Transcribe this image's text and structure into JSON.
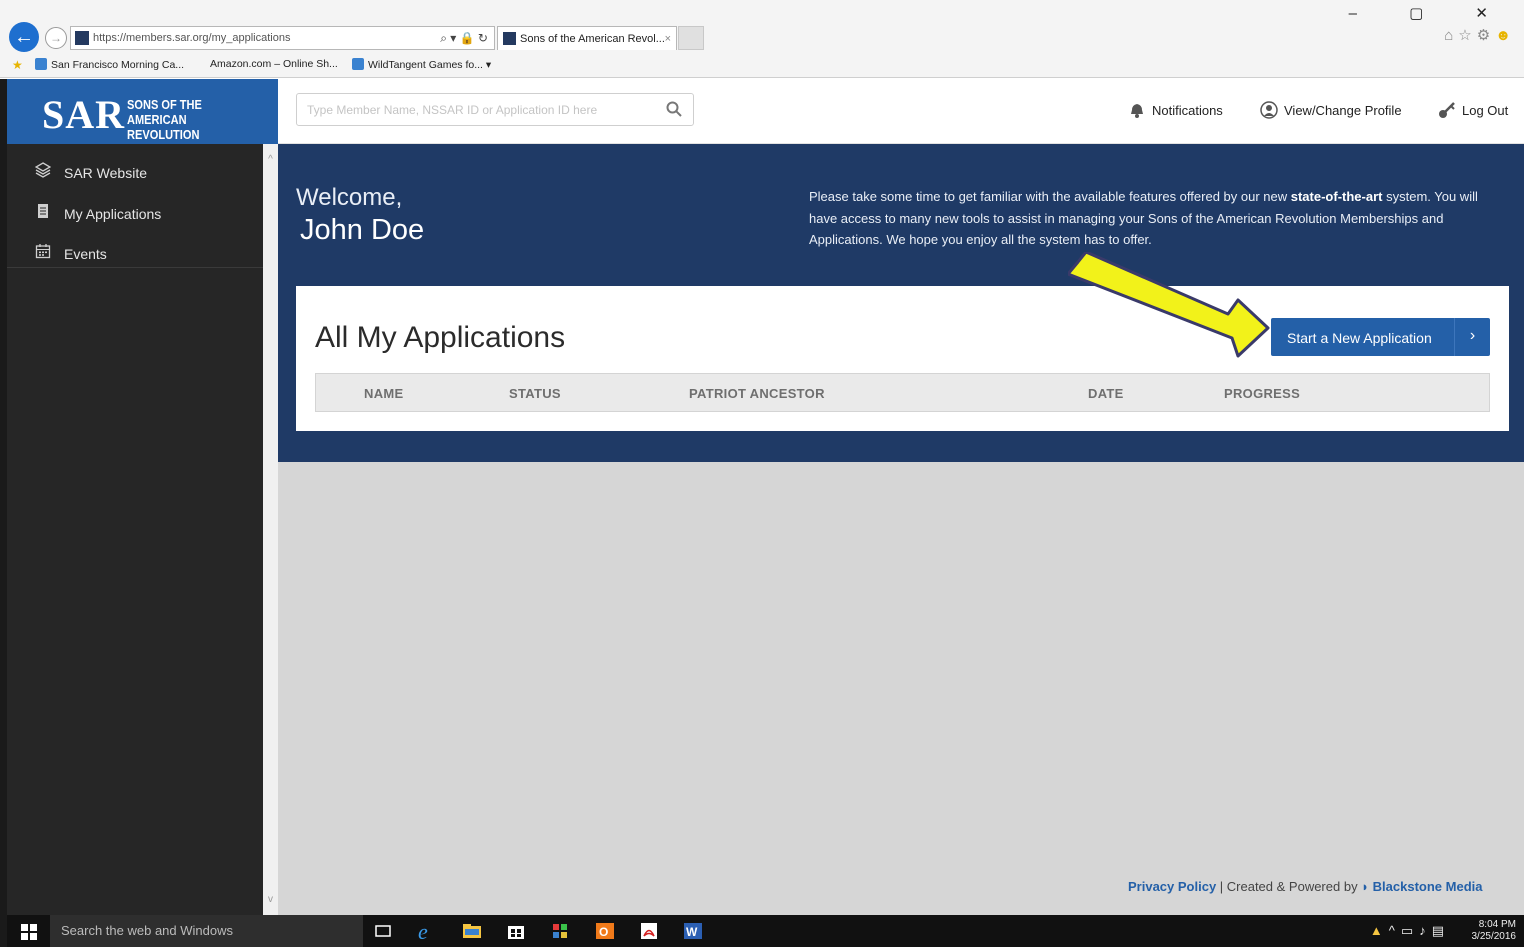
{
  "browser": {
    "url": "https://members.sar.org/my_applications",
    "tab_title": "Sons of the American Revol...",
    "tab_close": "×",
    "address_tools": "⌕ ▾ 🔒 ↻",
    "window_controls": "–  ▢  ✕",
    "favorites": [
      {
        "label": "San Francisco Morning Ca..."
      },
      {
        "label": "Amazon.com – Online Sh..."
      },
      {
        "label": "WildTangent Games fo... ▾"
      }
    ]
  },
  "logo": {
    "main": "SAR",
    "line1": "SONS OF THE",
    "line2": "AMERICAN REVOLUTION"
  },
  "search": {
    "placeholder": "Type Member Name, NSSAR ID or Application ID here"
  },
  "topnav": {
    "notifications": "Notifications",
    "profile": "View/Change Profile",
    "logout": "Log Out"
  },
  "sidebar": {
    "items": [
      {
        "label": "SAR Website",
        "icon": "layers-icon"
      },
      {
        "label": "My Applications",
        "icon": "document-icon"
      },
      {
        "label": "Events",
        "icon": "calendar-icon"
      }
    ]
  },
  "hero": {
    "welcome": "Welcome,",
    "name": "John Doe",
    "text_before_bold": "Please take some time to get familiar with the available features offered by our new ",
    "text_bold": "state-of-the-art",
    "text_after_bold": " system. You will have access to many new tools to assist in managing your Sons of the American Revolution Memberships and Applications. We hope you enjoy all the system has to offer."
  },
  "applications": {
    "title": "All My Applications",
    "new_button": "Start a New Application",
    "new_button_chevron": "›",
    "columns": [
      "NAME",
      "STATUS",
      "PATRIOT ANCESTOR",
      "DATE",
      "PROGRESS"
    ]
  },
  "footer": {
    "privacy": "Privacy Policy",
    "separator": " | Created & Powered by ",
    "company": "Blackstone Media"
  },
  "taskbar": {
    "search_placeholder": "Search the web and Windows",
    "time": "8:04 PM",
    "date": "3/25/2016"
  },
  "colors": {
    "brand_blue": "#2460a8",
    "hero_navy": "#1f3a66",
    "sidebar_dark": "#262626",
    "arrow_yellow": "#f2f21a"
  }
}
